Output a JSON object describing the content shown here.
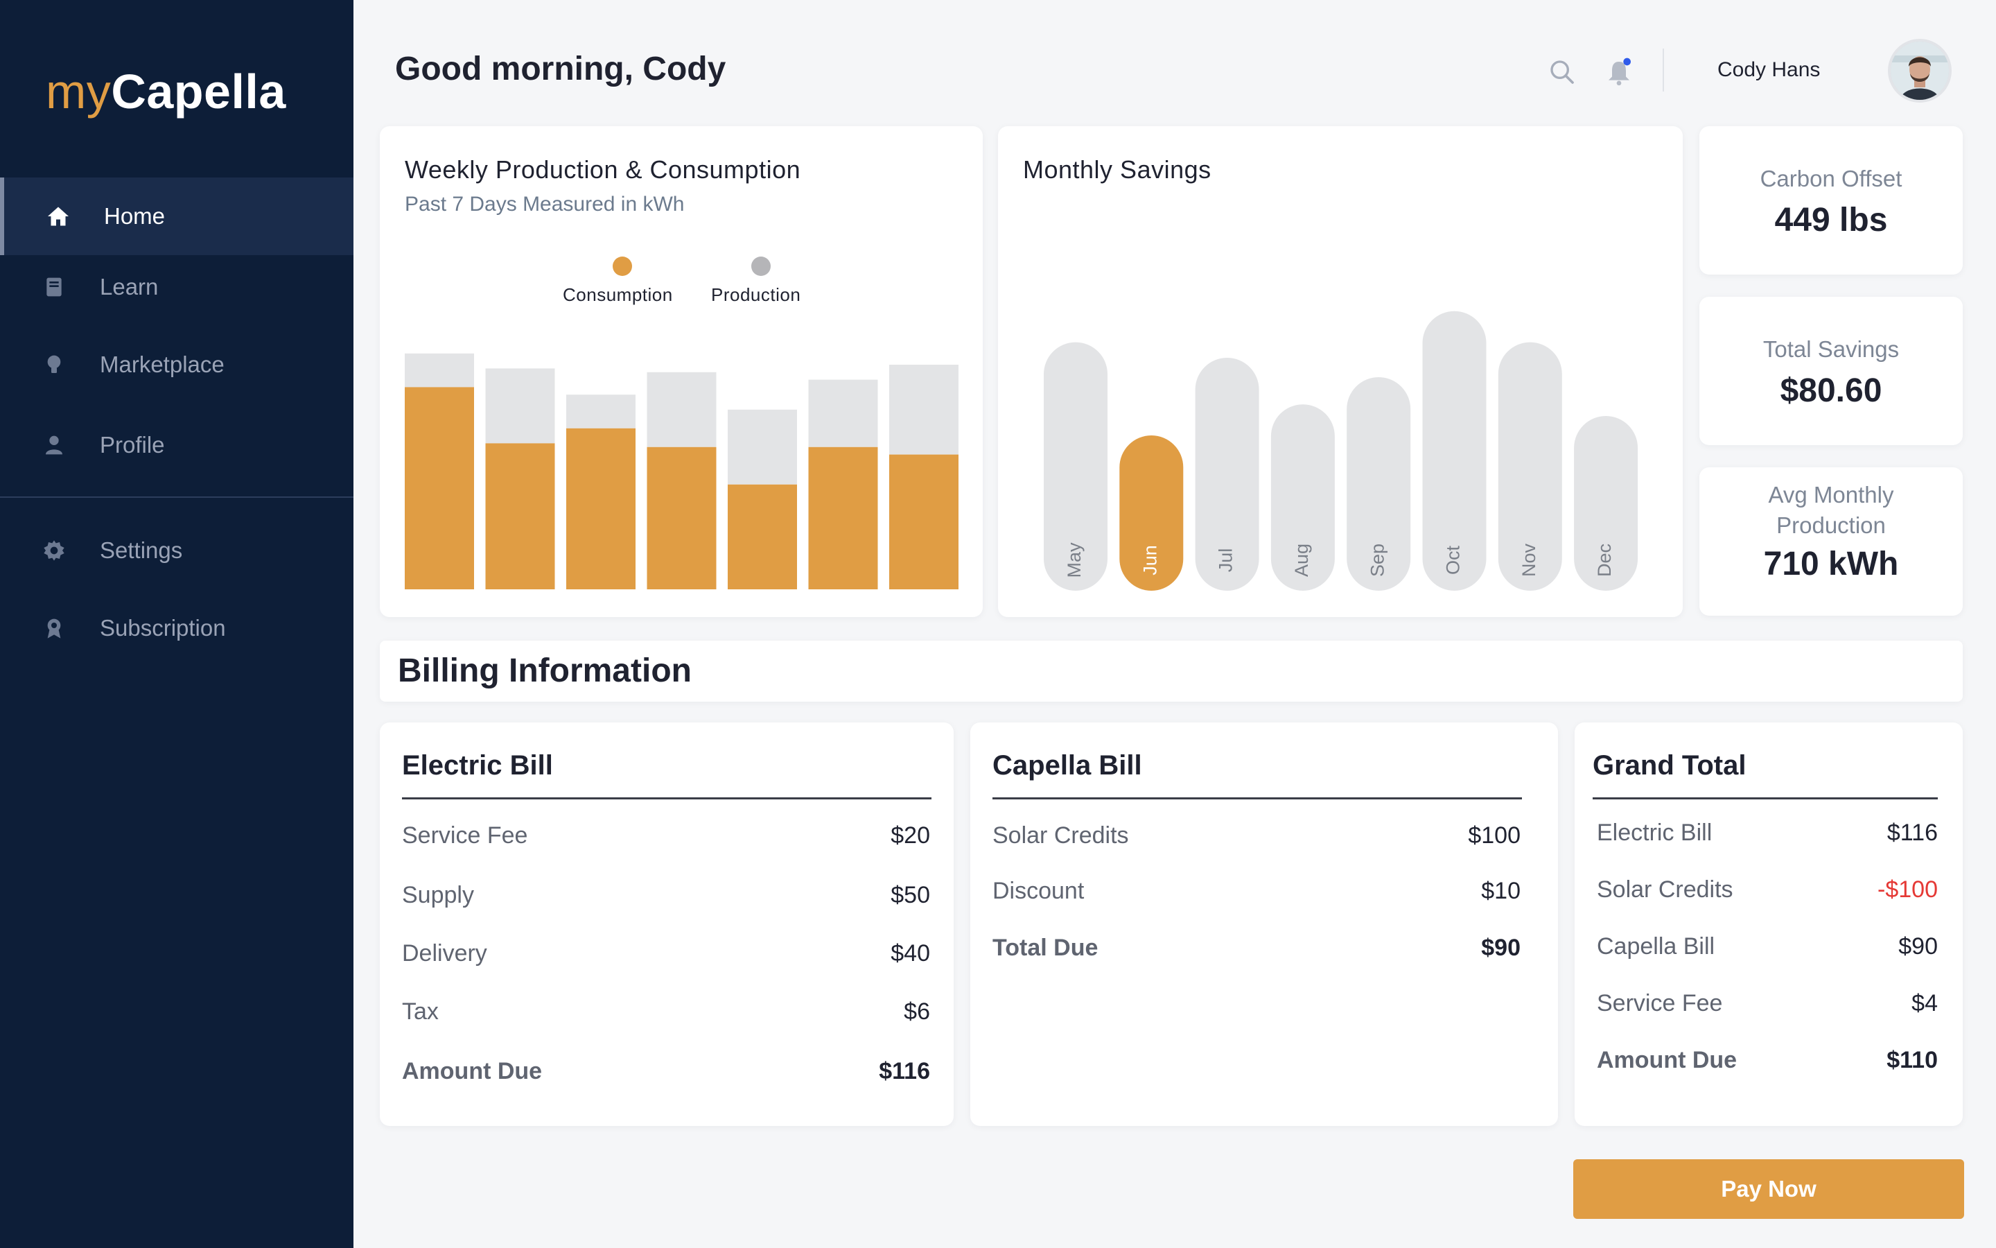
{
  "app": {
    "logo_prefix": "my",
    "logo_name": "Capella"
  },
  "sidebar": {
    "items": [
      {
        "label": "Home",
        "icon": "home-icon",
        "active": true
      },
      {
        "label": "Learn",
        "icon": "book-icon",
        "active": false
      },
      {
        "label": "Marketplace",
        "icon": "lightbulb-icon",
        "active": false
      },
      {
        "label": "Profile",
        "icon": "user-icon",
        "active": false
      },
      {
        "label": "Settings",
        "icon": "gear-icon",
        "active": false
      },
      {
        "label": "Subscription",
        "icon": "badge-icon",
        "active": false
      }
    ]
  },
  "header": {
    "greeting": "Good morning, Cody",
    "user_name": "Cody Hans",
    "search_icon": "search-icon",
    "bell_icon": "bell-icon",
    "has_notification": true
  },
  "weekly": {
    "title": "Weekly Production & Consumption",
    "subtitle": "Past 7 Days Measured in kWh",
    "legend_consumption": "Consumption",
    "legend_production": "Production"
  },
  "monthly": {
    "title": "Monthly Savings"
  },
  "stats": {
    "carbon_label": "Carbon Offset",
    "carbon_value": "449 lbs",
    "savings_label": "Total Savings",
    "savings_value": "$80.60",
    "avg_label_1": "Avg Monthly",
    "avg_label_2": "Production",
    "avg_value": "710 kWh"
  },
  "billing": {
    "heading": "Billing Information",
    "electric": {
      "title": "Electric Bill",
      "rows": [
        {
          "label": "Service Fee",
          "value": "$20"
        },
        {
          "label": "Supply",
          "value": "$50"
        },
        {
          "label": "Delivery",
          "value": "$40"
        },
        {
          "label": "Tax",
          "value": "$6"
        }
      ],
      "total_label": "Amount Due",
      "total_value": "$116"
    },
    "capella": {
      "title": "Capella Bill",
      "rows": [
        {
          "label": "Solar Credits",
          "value": "$100"
        },
        {
          "label": "Discount",
          "value": "$10"
        }
      ],
      "total_label": "Total Due",
      "total_value": "$90"
    },
    "grand": {
      "title": "Grand Total",
      "rows": [
        {
          "label": "Electric Bill",
          "value": "$116"
        },
        {
          "label": "Solar Credits",
          "value": "-$100"
        },
        {
          "label": "Capella Bill",
          "value": "$90"
        },
        {
          "label": "Service Fee",
          "value": "$4"
        }
      ],
      "total_label": "Amount Due",
      "total_value": "$110"
    },
    "pay_label": "Pay Now"
  },
  "colors": {
    "accent": "#e09d44",
    "sidebar_bg": "#0d1e38",
    "bar_gray": "#e3e4e6",
    "negative": "#e53935"
  },
  "chart_data": [
    {
      "type": "bar",
      "stacked": true,
      "categories": [
        "",
        "",
        "",
        "",
        "",
        "",
        ""
      ],
      "ylim": [
        0,
        100
      ],
      "series": [
        {
          "name": "Consumption",
          "color": "#e09d44",
          "values": [
            54,
            39,
            43,
            38,
            28,
            38,
            36
          ]
        },
        {
          "name": "Production",
          "color": "#e3e4e6",
          "values": [
            9,
            20,
            9,
            20,
            20,
            18,
            24
          ]
        }
      ]
    },
    {
      "type": "bar",
      "categories": [
        "May",
        "Jun",
        "Jul",
        "Aug",
        "Sep",
        "Oct",
        "Nov",
        "Dec"
      ],
      "values": [
        64,
        40,
        60,
        48,
        55,
        72,
        64,
        45
      ],
      "highlight": "Jun",
      "ylim": [
        0,
        100
      ]
    }
  ]
}
